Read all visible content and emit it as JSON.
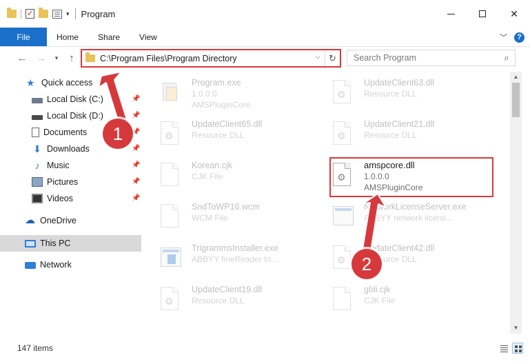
{
  "window": {
    "title": "Program",
    "minimize": "—",
    "close": "✕"
  },
  "ribbon": {
    "file": "File",
    "tabs": [
      "Home",
      "Share",
      "View"
    ],
    "help": "?"
  },
  "address": {
    "path": "C:\\Program Files\\Program Directory",
    "search_placeholder": "Search Program"
  },
  "sidebar": {
    "quick_access": "Quick access",
    "items": [
      {
        "label": "Local Disk (C:)"
      },
      {
        "label": "Local Disk (D:)"
      },
      {
        "label": "Documents"
      },
      {
        "label": "Downloads"
      },
      {
        "label": "Music"
      },
      {
        "label": "Pictures"
      },
      {
        "label": "Videos"
      }
    ],
    "onedrive": "OneDrive",
    "this_pc": "This PC",
    "network": "Network"
  },
  "files": [
    {
      "name": "Program.exe",
      "line2": "1.0.0.0",
      "line3": "AMSPluginCore"
    },
    {
      "name": "UpdateClient63.dll",
      "line2": "Resource DLL"
    },
    {
      "name": "UpdateClient65.dll",
      "line2": "Resource DLL"
    },
    {
      "name": "UpdateClient21.dll",
      "line2": "Resource DLL"
    },
    {
      "name": "Korean.cjk",
      "line2": "CJK File"
    },
    {
      "name": "amspcore.dll",
      "line2": "1.0.0.0",
      "line3": "AMSPluginCore"
    },
    {
      "name": "SndToWP16.wcm",
      "line2": "WCM File"
    },
    {
      "name": "NetworkLicenseServer.exe",
      "line2": "ABBYY network licens..."
    },
    {
      "name": "TrigrammsInstaller.exe",
      "line2": "ABBYY fineReader tri..."
    },
    {
      "name": "UpdateClient42.dll",
      "line2": "Resource DLL"
    },
    {
      "name": "UpdateClient19.dll",
      "line2": "Resource DLL"
    },
    {
      "name": "gbli.cjk",
      "line2": "CJK File"
    }
  ],
  "status": {
    "count": "147 items"
  },
  "annotations": {
    "step1": "1",
    "step2": "2",
    "color": "#d6393c"
  }
}
